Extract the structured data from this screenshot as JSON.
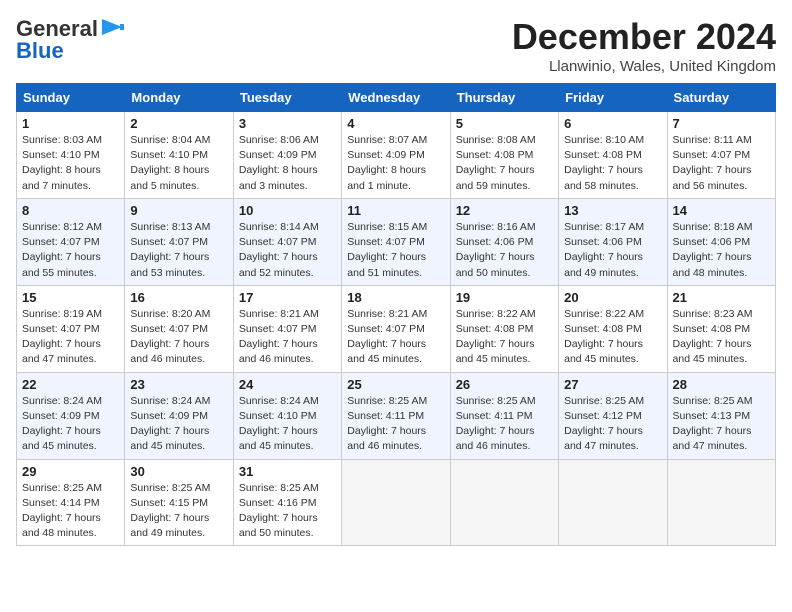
{
  "logo": {
    "line1": "General",
    "line2": "Blue"
  },
  "header": {
    "month": "December 2024",
    "location": "Llanwinio, Wales, United Kingdom"
  },
  "weekdays": [
    "Sunday",
    "Monday",
    "Tuesday",
    "Wednesday",
    "Thursday",
    "Friday",
    "Saturday"
  ],
  "weeks": [
    [
      {
        "day": "1",
        "sunrise": "8:03 AM",
        "sunset": "4:10 PM",
        "daylight": "8 hours and 7 minutes."
      },
      {
        "day": "2",
        "sunrise": "8:04 AM",
        "sunset": "4:10 PM",
        "daylight": "8 hours and 5 minutes."
      },
      {
        "day": "3",
        "sunrise": "8:06 AM",
        "sunset": "4:09 PM",
        "daylight": "8 hours and 3 minutes."
      },
      {
        "day": "4",
        "sunrise": "8:07 AM",
        "sunset": "4:09 PM",
        "daylight": "8 hours and 1 minute."
      },
      {
        "day": "5",
        "sunrise": "8:08 AM",
        "sunset": "4:08 PM",
        "daylight": "7 hours and 59 minutes."
      },
      {
        "day": "6",
        "sunrise": "8:10 AM",
        "sunset": "4:08 PM",
        "daylight": "7 hours and 58 minutes."
      },
      {
        "day": "7",
        "sunrise": "8:11 AM",
        "sunset": "4:07 PM",
        "daylight": "7 hours and 56 minutes."
      }
    ],
    [
      {
        "day": "8",
        "sunrise": "8:12 AM",
        "sunset": "4:07 PM",
        "daylight": "7 hours and 55 minutes."
      },
      {
        "day": "9",
        "sunrise": "8:13 AM",
        "sunset": "4:07 PM",
        "daylight": "7 hours and 53 minutes."
      },
      {
        "day": "10",
        "sunrise": "8:14 AM",
        "sunset": "4:07 PM",
        "daylight": "7 hours and 52 minutes."
      },
      {
        "day": "11",
        "sunrise": "8:15 AM",
        "sunset": "4:07 PM",
        "daylight": "7 hours and 51 minutes."
      },
      {
        "day": "12",
        "sunrise": "8:16 AM",
        "sunset": "4:06 PM",
        "daylight": "7 hours and 50 minutes."
      },
      {
        "day": "13",
        "sunrise": "8:17 AM",
        "sunset": "4:06 PM",
        "daylight": "7 hours and 49 minutes."
      },
      {
        "day": "14",
        "sunrise": "8:18 AM",
        "sunset": "4:06 PM",
        "daylight": "7 hours and 48 minutes."
      }
    ],
    [
      {
        "day": "15",
        "sunrise": "8:19 AM",
        "sunset": "4:07 PM",
        "daylight": "7 hours and 47 minutes."
      },
      {
        "day": "16",
        "sunrise": "8:20 AM",
        "sunset": "4:07 PM",
        "daylight": "7 hours and 46 minutes."
      },
      {
        "day": "17",
        "sunrise": "8:21 AM",
        "sunset": "4:07 PM",
        "daylight": "7 hours and 46 minutes."
      },
      {
        "day": "18",
        "sunrise": "8:21 AM",
        "sunset": "4:07 PM",
        "daylight": "7 hours and 45 minutes."
      },
      {
        "day": "19",
        "sunrise": "8:22 AM",
        "sunset": "4:08 PM",
        "daylight": "7 hours and 45 minutes."
      },
      {
        "day": "20",
        "sunrise": "8:22 AM",
        "sunset": "4:08 PM",
        "daylight": "7 hours and 45 minutes."
      },
      {
        "day": "21",
        "sunrise": "8:23 AM",
        "sunset": "4:08 PM",
        "daylight": "7 hours and 45 minutes."
      }
    ],
    [
      {
        "day": "22",
        "sunrise": "8:24 AM",
        "sunset": "4:09 PM",
        "daylight": "7 hours and 45 minutes."
      },
      {
        "day": "23",
        "sunrise": "8:24 AM",
        "sunset": "4:09 PM",
        "daylight": "7 hours and 45 minutes."
      },
      {
        "day": "24",
        "sunrise": "8:24 AM",
        "sunset": "4:10 PM",
        "daylight": "7 hours and 45 minutes."
      },
      {
        "day": "25",
        "sunrise": "8:25 AM",
        "sunset": "4:11 PM",
        "daylight": "7 hours and 46 minutes."
      },
      {
        "day": "26",
        "sunrise": "8:25 AM",
        "sunset": "4:11 PM",
        "daylight": "7 hours and 46 minutes."
      },
      {
        "day": "27",
        "sunrise": "8:25 AM",
        "sunset": "4:12 PM",
        "daylight": "7 hours and 47 minutes."
      },
      {
        "day": "28",
        "sunrise": "8:25 AM",
        "sunset": "4:13 PM",
        "daylight": "7 hours and 47 minutes."
      }
    ],
    [
      {
        "day": "29",
        "sunrise": "8:25 AM",
        "sunset": "4:14 PM",
        "daylight": "7 hours and 48 minutes."
      },
      {
        "day": "30",
        "sunrise": "8:25 AM",
        "sunset": "4:15 PM",
        "daylight": "7 hours and 49 minutes."
      },
      {
        "day": "31",
        "sunrise": "8:25 AM",
        "sunset": "4:16 PM",
        "daylight": "7 hours and 50 minutes."
      },
      null,
      null,
      null,
      null
    ]
  ]
}
